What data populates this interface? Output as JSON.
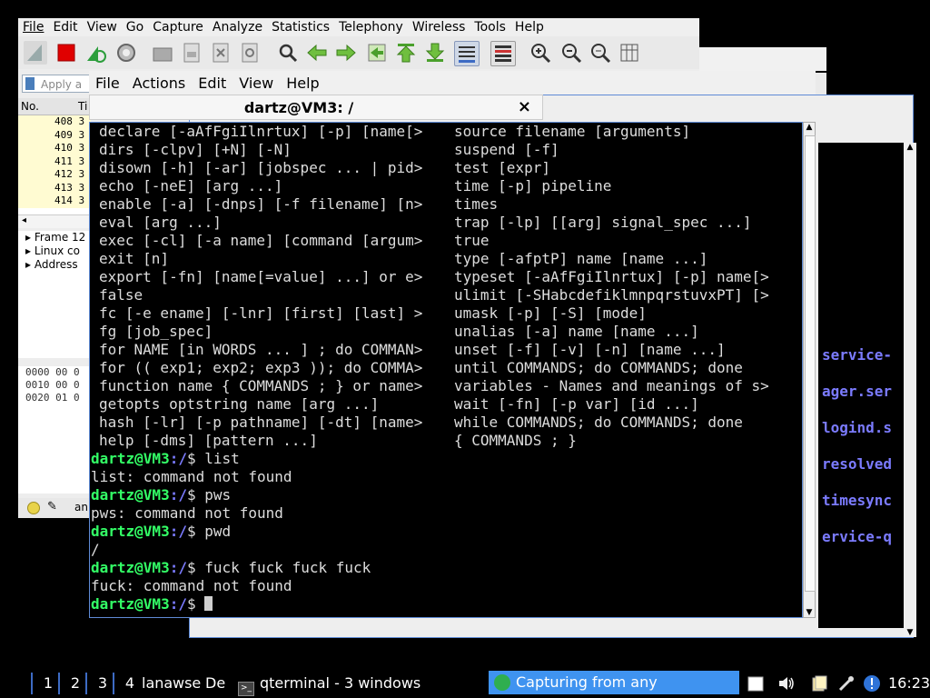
{
  "wireshark": {
    "menu": [
      "File",
      "Edit",
      "View",
      "Go",
      "Capture",
      "Analyze",
      "Statistics",
      "Telephony",
      "Wireless",
      "Tools",
      "Help"
    ],
    "filter_placeholder": "Apply a c",
    "list_header": "No.",
    "list_header2": "Ti",
    "rows": [
      "408 3",
      "409 3",
      "410 3",
      "411 3",
      "412 3",
      "413 3",
      "414 3"
    ],
    "detail": [
      "Frame 12",
      "Linux co",
      "Address"
    ],
    "bytes": [
      "0000  00 0",
      "0010  00 0",
      "0020  01 0"
    ],
    "status_text": "an"
  },
  "filemanager": {
    "items": [
      "service-",
      "ager.ser",
      "logind.s",
      "resolved",
      "timesync",
      "ervice-q"
    ]
  },
  "terminal": {
    "menu": [
      "File",
      "Actions",
      "Edit",
      "View",
      "Help"
    ],
    "tab_title": "dartz@VM3: /",
    "tab_close": "×",
    "left_col": [
      "declare [-aAfFgiIlnrtux] [-p] [name[>",
      "dirs [-clpv] [+N] [-N]",
      "disown [-h] [-ar] [jobspec ... | pid>",
      "echo [-neE] [arg ...]",
      "enable [-a] [-dnps] [-f filename] [n>",
      "eval [arg ...]",
      "exec [-cl] [-a name] [command [argum>",
      "exit [n]",
      "export [-fn] [name[=value] ...] or e>",
      "false",
      "fc [-e ename] [-lnr] [first] [last] >",
      "fg [job_spec]",
      "for NAME [in WORDS ... ] ; do COMMAN>",
      "for (( exp1; exp2; exp3 )); do COMMA>",
      "function name { COMMANDS ; } or name>",
      "getopts optstring name [arg ...]",
      "hash [-lr] [-p pathname] [-dt] [name>",
      "help [-dms] [pattern ...]"
    ],
    "right_col": [
      "source filename [arguments]",
      "suspend [-f]",
      "test [expr]",
      "time [-p] pipeline",
      "times",
      "trap [-lp] [[arg] signal_spec ...]",
      "true",
      "type [-afptP] name [name ...]",
      "typeset [-aAfFgiIlnrtux] [-p] name[>",
      "ulimit [-SHabcdefiklmnpqrstuvxPT] [>",
      "umask [-p] [-S] [mode]",
      "unalias [-a] name [name ...]",
      "unset [-f] [-v] [-n] [name ...]",
      "until COMMANDS; do COMMANDS; done",
      "variables - Names and meanings of s>",
      "wait [-fn] [-p var] [id ...]",
      "while COMMANDS; do COMMANDS; done",
      "{ COMMANDS ; }"
    ],
    "session": [
      {
        "type": "prompt",
        "user": "dartz@VM3",
        "cwd": ":/",
        "cmd": "$ list"
      },
      {
        "type": "out",
        "text": "list: command not found"
      },
      {
        "type": "prompt",
        "user": "dartz@VM3",
        "cwd": ":/",
        "cmd": "$ pws"
      },
      {
        "type": "out",
        "text": "pws: command not found"
      },
      {
        "type": "prompt",
        "user": "dartz@VM3",
        "cwd": ":/",
        "cmd": "$ pwd"
      },
      {
        "type": "out",
        "text": "/"
      },
      {
        "type": "prompt",
        "user": "dartz@VM3",
        "cwd": ":/",
        "cmd": "$ fuck fuck fuck fuck"
      },
      {
        "type": "out",
        "text": "fuck: command not found"
      },
      {
        "type": "prompt",
        "user": "dartz@VM3",
        "cwd": ":/",
        "cmd": "$ "
      }
    ]
  },
  "taskbar": {
    "workspaces": [
      "1",
      "2",
      "3",
      "4"
    ],
    "extra1": "lana",
    "extra2": "wse",
    "extra3": "De",
    "term_task": "qterminal - 3 windows",
    "ws_task": "Capturing from any",
    "clock": "16:23"
  },
  "colors": {
    "prompt": "#33ff66",
    "cwd": "#7b7bff",
    "accent": "#3f93f0"
  }
}
